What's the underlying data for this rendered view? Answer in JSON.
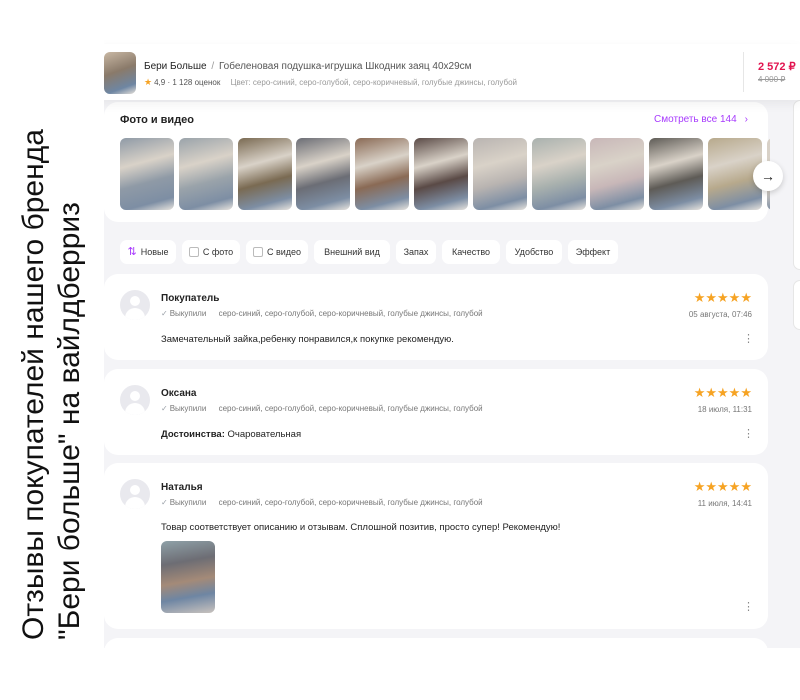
{
  "caption": "Отзывы покупателей нашего бренда \"Бери больше\" на вайлдберриз",
  "product": {
    "brand": "Бери Больше",
    "separator": "/",
    "name": "Гобеленовая подушка-игрушка Шкодник заяц 40х29см",
    "rating": "4,9",
    "reviews_count": "· 1 128 оценок",
    "color_label": "Цвет: серо-синий, серо-голубой, серо-коричневый, голубые джинсы, голубой",
    "price": "2 572 ₽",
    "old_price": "4 000 ₽"
  },
  "photos": {
    "title": "Фото и видео",
    "see_all": "Смотреть все 144",
    "see_all_icon": "chevron-right-icon",
    "next_icon": "arrow-right-icon",
    "tiles": [
      "#8f9aa6",
      "#9aa3aa",
      "#7a6a52",
      "#6b6d75",
      "#8a6a55",
      "#5a4a46",
      "#b9b4b1",
      "#a9b1ae",
      "#c8b7b8",
      "#5e5b56",
      "#b7a98c",
      "#d8d0c6"
    ]
  },
  "filters": [
    {
      "label": "Новые",
      "icon": "sort-icon"
    },
    {
      "label": "С фото",
      "icon": "checkbox-icon"
    },
    {
      "label": "С видео",
      "icon": "checkbox-icon"
    },
    {
      "label": "Внешний вид"
    },
    {
      "label": "Запах"
    },
    {
      "label": "Качество"
    },
    {
      "label": "Удобство"
    },
    {
      "label": "Эффект"
    }
  ],
  "reviews": [
    {
      "author": "Покупатель",
      "bought": "Выкупили",
      "colors": "серо-синий, серо-голубой, серо-коричневый, голубые джинсы, голубой",
      "stars": "★★★★★",
      "date": "05 августа, 07:46",
      "text": "Замечательный зайка,ребенку понравился,к покупке рекомендую.",
      "text_label": ""
    },
    {
      "author": "Оксана",
      "bought": "Выкупили",
      "colors": "серо-синий, серо-голубой, серо-коричневый, голубые джинсы, голубой",
      "stars": "★★★★★",
      "date": "18 июля, 11:31",
      "text_label": "Достоинства:",
      "text": "Очаровательная"
    },
    {
      "author": "Наталья",
      "bought": "Выкупили",
      "colors": "серо-синий, серо-голубой, серо-коричневый, голубые джинсы, голубой",
      "stars": "★★★★★",
      "date": "11 июля, 14:41",
      "text": "Товар соответствует описанию и отзывам. Сплошной позитив, просто супер! Рекомендую!",
      "text_label": ""
    }
  ],
  "colors": {
    "accent": "#a73afd",
    "price": "#e2134f",
    "star": "#f6a323",
    "feed_bg": "#f4f4f7"
  }
}
